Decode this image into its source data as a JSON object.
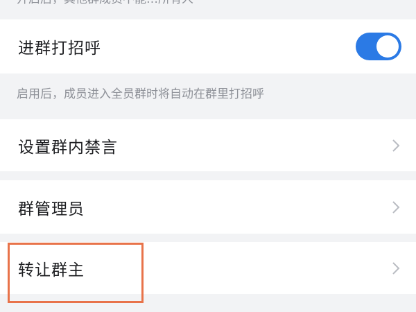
{
  "top_hint": "开启后，其他群成员不能…所有人",
  "greet_row": {
    "label": "进群打招呼",
    "toggle_on": true,
    "toggle_color": "#2b7ae5"
  },
  "greet_hint": "启用后，成员进入全员群时将自动在群里打招呼",
  "mute_row": {
    "label": "设置群内禁言"
  },
  "admin_row": {
    "label": "群管理员"
  },
  "transfer_row": {
    "label": "转让群主"
  },
  "highlight_color": "#e8734a"
}
